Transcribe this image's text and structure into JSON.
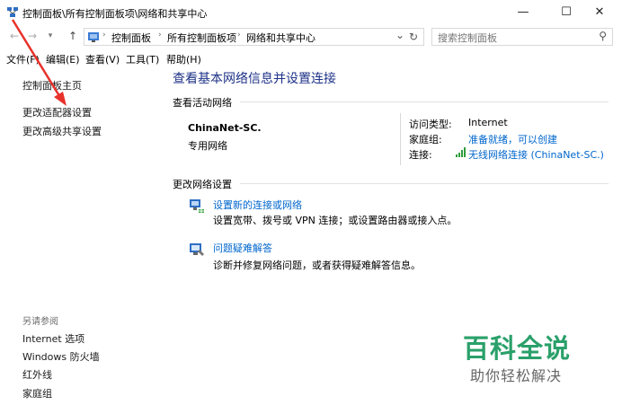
{
  "window": {
    "title": "控制面板\\所有控制面板项\\网络和共享中心",
    "minimize_glyph": "—",
    "maximize_glyph": "☐",
    "close_glyph": "✕"
  },
  "nav": {
    "back_glyph": "←",
    "forward_glyph": "→",
    "recent_glyph": "▾",
    "up_glyph": "↑"
  },
  "address": {
    "crumbs": [
      "控制面板",
      "所有控制面板项",
      "网络和共享中心"
    ],
    "sep_glyph": "›",
    "dropdown_glyph": "⌄",
    "refresh_glyph": "↻"
  },
  "search": {
    "placeholder": "搜索控制面板",
    "icon_glyph": "⚲"
  },
  "menu": [
    "文件(F)",
    "编辑(E)",
    "查看(V)",
    "工具(T)",
    "帮助(H)"
  ],
  "sidebar": {
    "items": [
      "控制面板主页",
      "更改适配器设置",
      "更改高级共享设置"
    ],
    "see_also_title": "另请参阅",
    "see_also": [
      "Internet 选项",
      "Windows 防火墙",
      "红外线",
      "家庭组"
    ]
  },
  "main": {
    "title": "查看基本网络信息并设置连接",
    "active_networks_label": "查看活动网络",
    "network": {
      "name": "ChinaNet-SC.",
      "type": "专用网络",
      "access_type_label": "访问类型:",
      "access_type_value": "Internet",
      "homegroup_label": "家庭组:",
      "homegroup_value": "准备就绪，可以创建",
      "connection_label": "连接:",
      "connection_value": "无线网络连接 (ChinaNet-SC.)"
    },
    "change_settings_label": "更改网络设置",
    "tasks": [
      {
        "link": "设置新的连接或网络",
        "desc": "设置宽带、拨号或 VPN 连接；或设置路由器或接入点。"
      },
      {
        "link": "问题疑难解答",
        "desc": "诊断并修复网络问题，或者获得疑难解答信息。"
      }
    ]
  },
  "watermark": {
    "title": "百科全说",
    "subtitle": "助你轻松解决"
  },
  "colors": {
    "link_blue": "#0066cc",
    "title_blue": "#1e3287",
    "annotation_red": "#e8312a",
    "watermark_green": "#2aa06a"
  }
}
